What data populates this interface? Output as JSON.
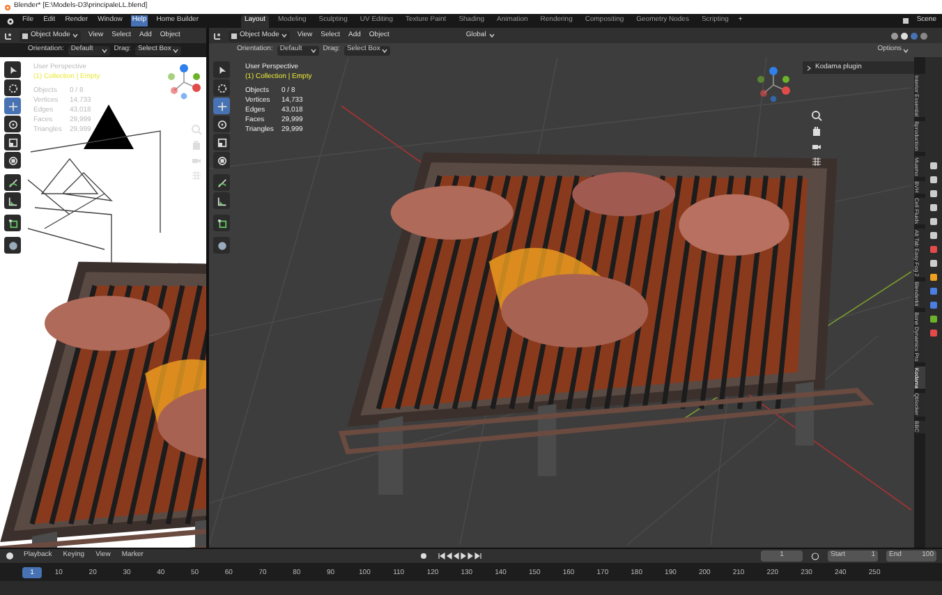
{
  "window": {
    "title": "Blender* [E:\\Models-D3\\principaleLL.blend]"
  },
  "menu": [
    {
      "label": "File",
      "selected": false
    },
    {
      "label": "Edit",
      "selected": false
    },
    {
      "label": "Render",
      "selected": false
    },
    {
      "label": "Window",
      "selected": false
    },
    {
      "label": "Help",
      "selected": true
    },
    {
      "label": "Home Builder",
      "selected": false
    }
  ],
  "workspaces": [
    {
      "label": "Layout",
      "selected": true
    },
    {
      "label": "Modeling",
      "selected": false
    },
    {
      "label": "Sculpting",
      "selected": false
    },
    {
      "label": "UV Editing",
      "selected": false
    },
    {
      "label": "Texture Paint",
      "selected": false
    },
    {
      "label": "Shading",
      "selected": false
    },
    {
      "label": "Animation",
      "selected": false
    },
    {
      "label": "Rendering",
      "selected": false
    },
    {
      "label": "Compositing",
      "selected": false
    },
    {
      "label": "Geometry Nodes",
      "selected": false
    },
    {
      "label": "Scripting",
      "selected": false
    }
  ],
  "add_workspace": "+",
  "scene": "Scene",
  "left_viewport": {
    "mode": "Object Mode",
    "menus": [
      "View",
      "Select",
      "Add",
      "Object"
    ],
    "orientation_label": "Orientation:",
    "orientation": "Default",
    "drag_label": "Drag:",
    "drag": "Select Box",
    "perspective": "User Perspective",
    "collection": "(1) Collection | Empty",
    "stats": [
      {
        "label": "Objects",
        "value": "0 / 8"
      },
      {
        "label": "Vertices",
        "value": "14,733"
      },
      {
        "label": "Edges",
        "value": "43,018"
      },
      {
        "label": "Faces",
        "value": "29,999"
      },
      {
        "label": "Triangles",
        "value": "29,999"
      }
    ],
    "tools": [
      {
        "kind": "select",
        "selected": false
      },
      {
        "kind": "cursor",
        "selected": false
      },
      {
        "kind": "move",
        "selected": true
      },
      {
        "kind": "rotate",
        "selected": false
      },
      {
        "kind": "scale",
        "selected": false
      },
      {
        "kind": "transform",
        "selected": false
      },
      {
        "kind": "annotate",
        "selected": false
      },
      {
        "kind": "measure",
        "selected": false
      },
      {
        "kind": "add-cube",
        "selected": false
      },
      {
        "kind": "sphere",
        "selected": false
      }
    ]
  },
  "main_viewport": {
    "mode": "Object Mode",
    "menus": [
      "View",
      "Select",
      "Add",
      "Object"
    ],
    "transform": "Global",
    "options": "Options",
    "orientation_label": "Orientation:",
    "orientation": "Default",
    "drag_label": "Drag:",
    "drag": "Select Box",
    "panel": "Kodama plugin",
    "perspective": "User Perspective",
    "collection": "(1) Collection | Empty",
    "stats": [
      {
        "label": "Objects",
        "value": "0 / 8"
      },
      {
        "label": "Vertices",
        "value": "14,733"
      },
      {
        "label": "Edges",
        "value": "43,018"
      },
      {
        "label": "Faces",
        "value": "29,999"
      },
      {
        "label": "Triangles",
        "value": "29,999"
      }
    ],
    "tools": [
      {
        "kind": "select",
        "selected": false
      },
      {
        "kind": "cursor",
        "selected": false
      },
      {
        "kind": "move",
        "selected": true
      },
      {
        "kind": "rotate",
        "selected": false
      },
      {
        "kind": "scale",
        "selected": false
      },
      {
        "kind": "transform",
        "selected": false
      },
      {
        "kind": "annotate",
        "selected": false
      },
      {
        "kind": "measure",
        "selected": false
      },
      {
        "kind": "add-cube",
        "selected": false
      },
      {
        "kind": "sphere",
        "selected": false
      }
    ],
    "sidebar_tabs": [
      {
        "label": "Interior Essential",
        "selected": false
      },
      {
        "label": "Bproduction",
        "selected": false
      },
      {
        "label": "Muamo",
        "selected": false
      },
      {
        "label": "BVH",
        "selected": false
      },
      {
        "label": "Cell Fluids",
        "selected": false
      },
      {
        "label": "Alt Tab Easy Fog 2",
        "selected": false
      },
      {
        "label": "Blenderkit",
        "selected": false
      },
      {
        "label": "Bone Dynamics Pro",
        "selected": false
      },
      {
        "label": "Kodama",
        "selected": true
      },
      {
        "label": "Qblocker",
        "selected": false
      },
      {
        "label": "BBC",
        "selected": false
      }
    ]
  },
  "timeline": {
    "menus": [
      "Playback",
      "Keying",
      "View",
      "Marker"
    ],
    "current_frame": "1",
    "start_label": "Start",
    "start": "1",
    "end_label": "End",
    "end": "100",
    "ruler": [
      {
        "label": "1",
        "selected": true
      },
      {
        "label": "10",
        "selected": false
      },
      {
        "label": "20",
        "selected": false
      },
      {
        "label": "30",
        "selected": false
      },
      {
        "label": "40",
        "selected": false
      },
      {
        "label": "50",
        "selected": false
      },
      {
        "label": "60",
        "selected": false
      },
      {
        "label": "70",
        "selected": false
      },
      {
        "label": "80",
        "selected": false
      },
      {
        "label": "90",
        "selected": false
      },
      {
        "label": "100",
        "selected": false
      },
      {
        "label": "110",
        "selected": false
      },
      {
        "label": "120",
        "selected": false
      },
      {
        "label": "130",
        "selected": false
      },
      {
        "label": "140",
        "selected": false
      },
      {
        "label": "150",
        "selected": false
      },
      {
        "label": "160",
        "selected": false
      },
      {
        "label": "170",
        "selected": false
      },
      {
        "label": "180",
        "selected": false
      },
      {
        "label": "190",
        "selected": false
      },
      {
        "label": "200",
        "selected": false
      },
      {
        "label": "210",
        "selected": false
      },
      {
        "label": "220",
        "selected": false
      },
      {
        "label": "230",
        "selected": false
      },
      {
        "label": "240",
        "selected": false
      },
      {
        "label": "250",
        "selected": false
      }
    ]
  }
}
